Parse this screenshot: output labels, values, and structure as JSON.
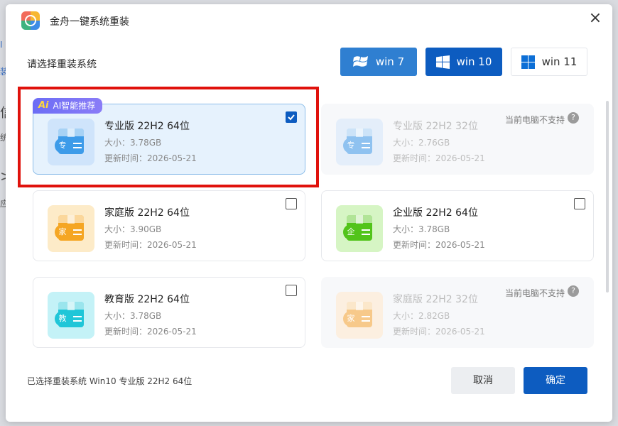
{
  "title": "金舟一键系统重装",
  "section_title": "请选择重装系统",
  "os_tabs": [
    {
      "label": "win 7",
      "active": false
    },
    {
      "label": "win 10",
      "active": true
    },
    {
      "label": "win 11",
      "active": false
    }
  ],
  "ai_tag": {
    "icon": "Ai",
    "label": "AI智能推荐"
  },
  "cards": [
    {
      "name": "专业版 22H2 64位",
      "size": "大小：3.78GB",
      "date": "更新时间：2026-05-21",
      "badge": "专",
      "color": "#3d9be9",
      "bg": "#cfe4fb",
      "checked": true,
      "disabled": false
    },
    {
      "name": "专业版 22H2 32位",
      "size": "大小：2.76GB",
      "date": "更新时间：2026-05-21",
      "badge": "专",
      "color": "#8fc2f0",
      "bg": "#e4eefa",
      "checked": false,
      "disabled": true,
      "note": "当前电脑不支持"
    },
    {
      "name": "家庭版 22H2 64位",
      "size": "大小：3.90GB",
      "date": "更新时间：2026-05-21",
      "badge": "家",
      "color": "#f5a623",
      "bg": "#fdebc8",
      "checked": false,
      "disabled": false
    },
    {
      "name": "企业版 22H2 64位",
      "size": "大小：3.78GB",
      "date": "更新时间：2026-05-21",
      "badge": "企",
      "color": "#52c41a",
      "bg": "#d6f5c4",
      "checked": false,
      "disabled": false
    },
    {
      "name": "教育版 22H2 64位",
      "size": "大小：3.78GB",
      "date": "更新时间：2026-05-21",
      "badge": "教",
      "color": "#1fc6d8",
      "bg": "#c4f2f7",
      "checked": false,
      "disabled": false
    },
    {
      "name": "家庭版 22H2 32位",
      "size": "大小：2.82GB",
      "date": "更新时间：2026-05-21",
      "badge": "家",
      "color": "#f7c98a",
      "bg": "#fcefe0",
      "checked": false,
      "disabled": true,
      "note": "当前电脑不支持"
    }
  ],
  "help_icon": "?",
  "footer": {
    "selected_text": "已选择重装系统  Win10 专业版 22H2 64位",
    "cancel": "取消",
    "confirm": "确定"
  },
  "close_icon": "×",
  "colors": {
    "primary": "#0d5cc0",
    "win7": "#2f7fd1",
    "highlight": "#e0120c",
    "ai_tag": "#6c6df5"
  }
}
